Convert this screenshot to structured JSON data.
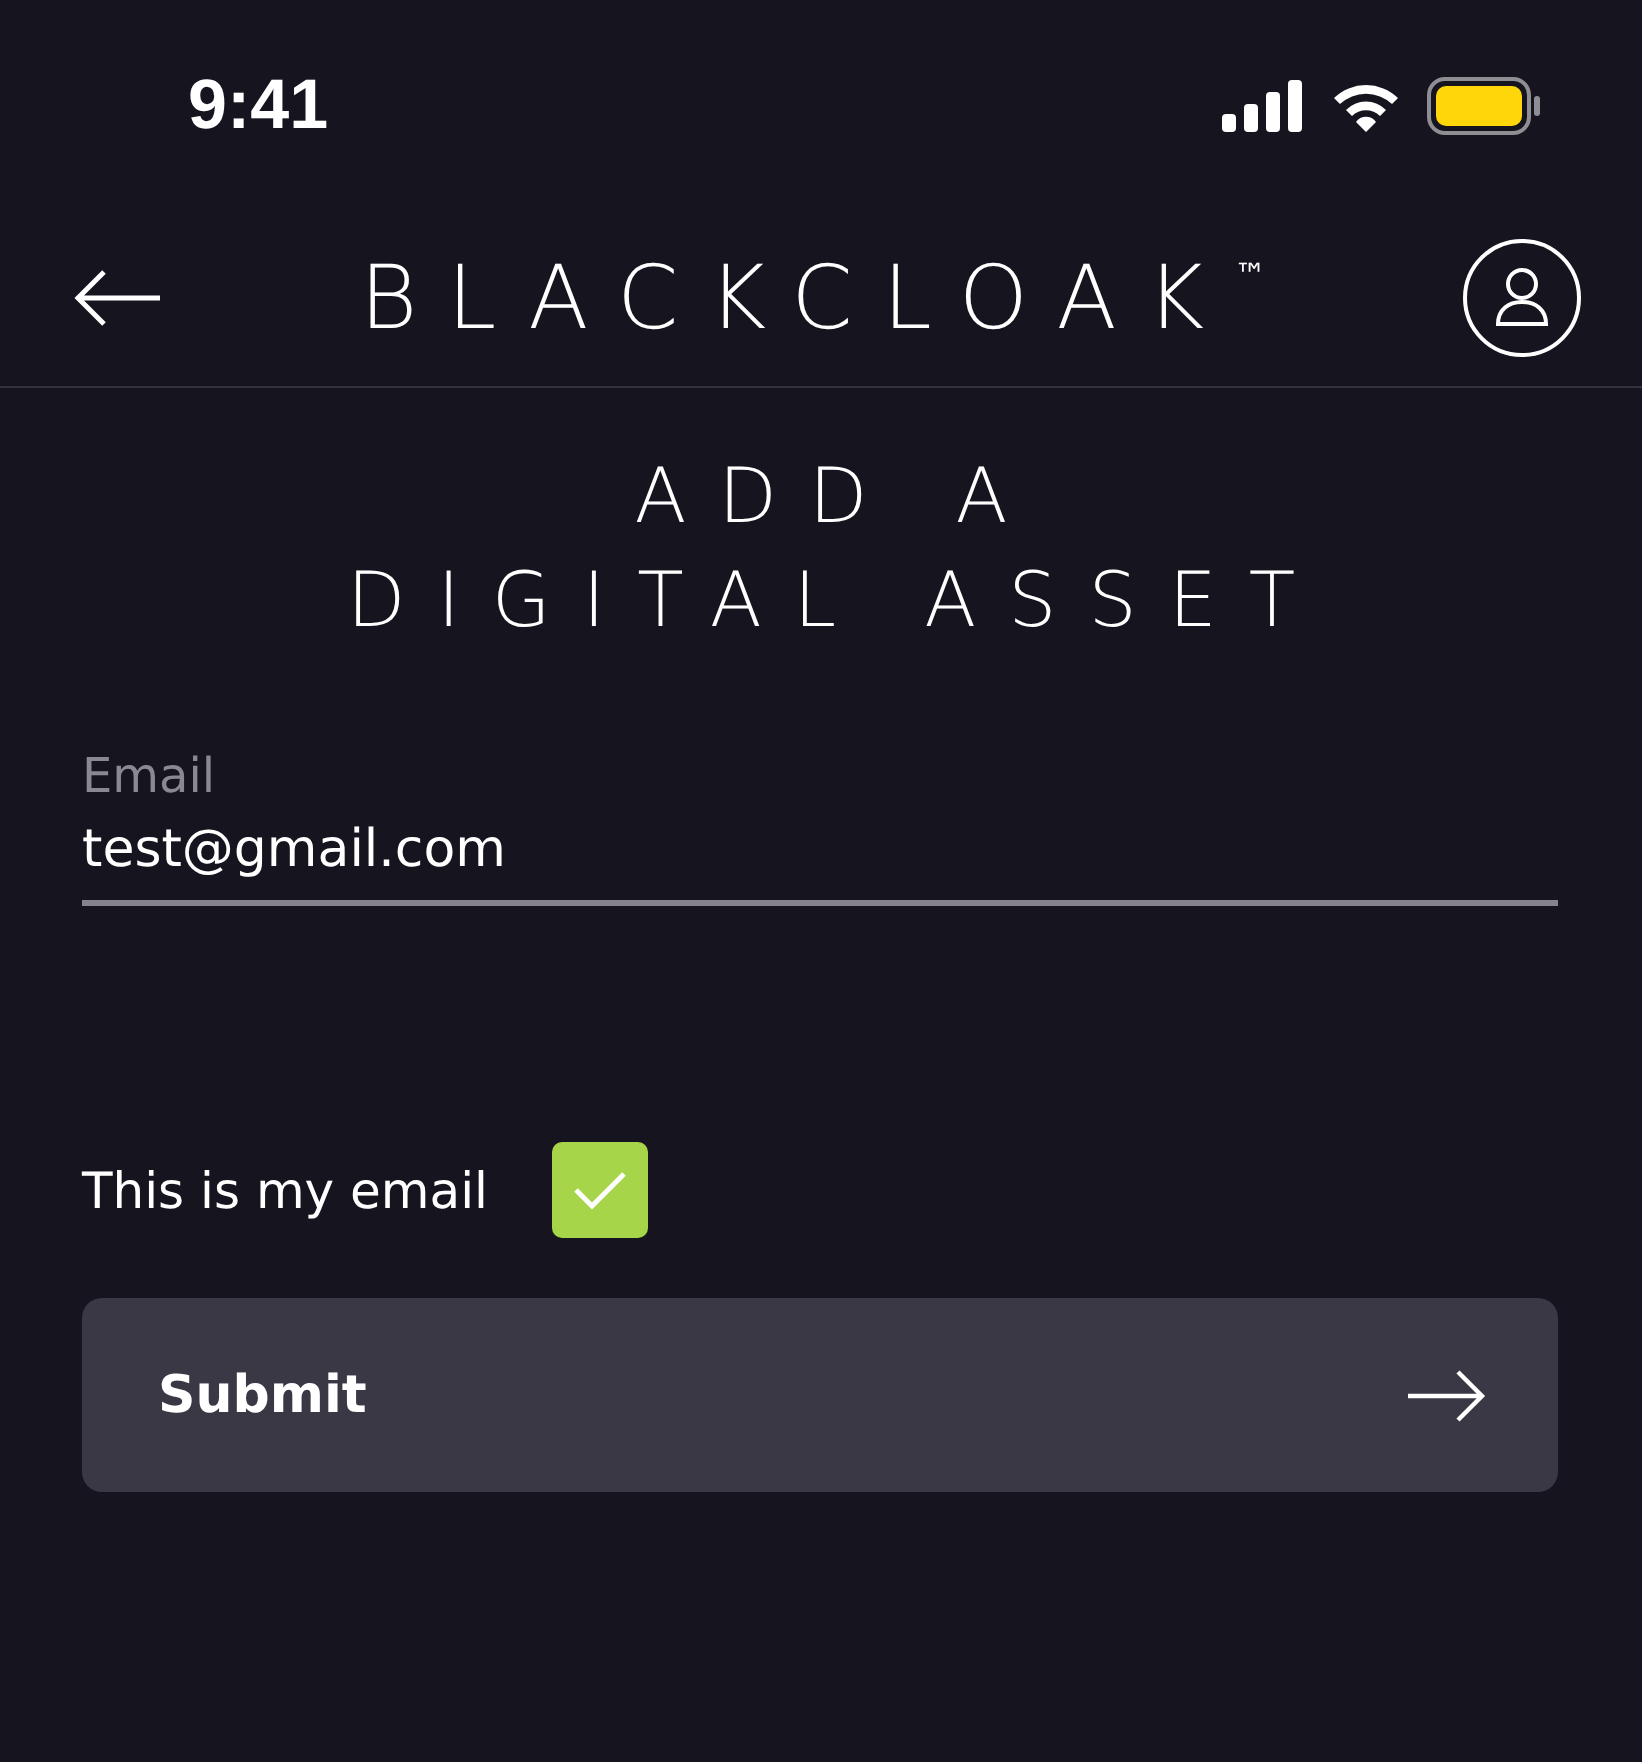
{
  "status_bar": {
    "time": "9:41"
  },
  "header": {
    "logo": "BLACKCLOAK",
    "trademark": "™"
  },
  "title": {
    "lines": [
      "ADD A",
      "DIGITAL ASSET"
    ]
  },
  "email_field": {
    "label": "Email",
    "value": "test@gmail.com"
  },
  "confirm": {
    "label": "This is my email",
    "checked": true
  },
  "submit": {
    "label": "Submit"
  }
}
